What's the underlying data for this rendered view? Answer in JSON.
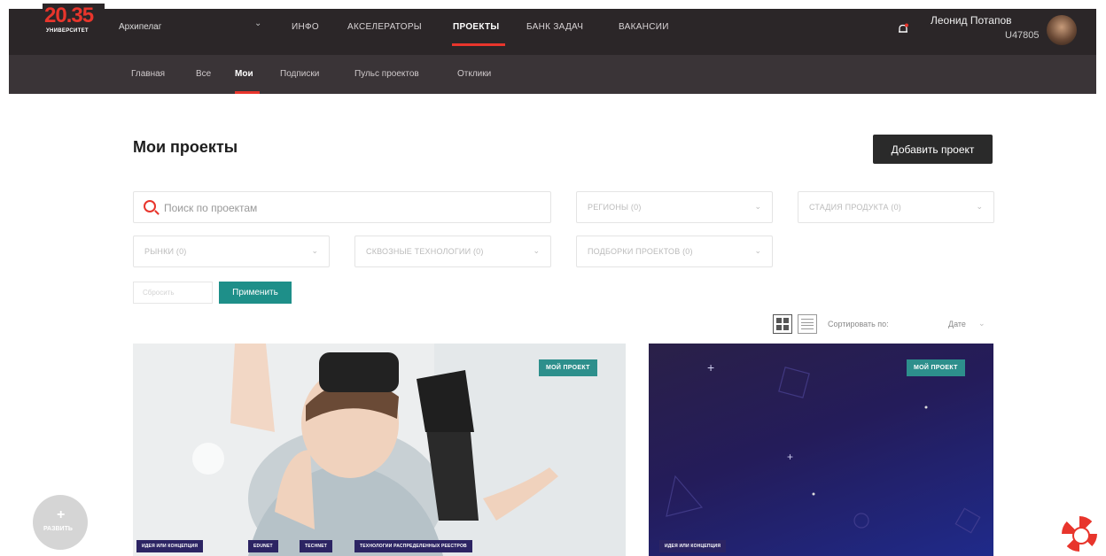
{
  "logo": {
    "number": "20.35",
    "subtitle": "УНИВЕРСИТЕТ"
  },
  "archipelago": {
    "label": "Архипелаг"
  },
  "top_nav": [
    {
      "label": "ИНФО",
      "active": false
    },
    {
      "label": "АКСЕЛЕРАТОРЫ",
      "active": false
    },
    {
      "label": "ПРОЕКТЫ",
      "active": true
    },
    {
      "label": "БАНК ЗАДАЧ",
      "active": false
    },
    {
      "label": "ВАКАНСИИ",
      "active": false
    }
  ],
  "sub_nav": [
    {
      "label": "Главная",
      "active": false
    },
    {
      "label": "Все",
      "active": false
    },
    {
      "label": "Мои",
      "active": true
    },
    {
      "label": "Подписки",
      "active": false
    },
    {
      "label": "Пульс проектов",
      "active": false
    },
    {
      "label": "Отклики",
      "active": false
    }
  ],
  "user": {
    "name": "Леонид Потапов",
    "id": "U47805"
  },
  "page": {
    "title": "Мои проекты",
    "add_button": "Добавить проект"
  },
  "filters": {
    "search_placeholder": "Поиск по проектам",
    "regions": "РЕГИОНЫ (0)",
    "product_stage": "СТАДИЯ ПРОДУКТА (0)",
    "markets": "РЫНКИ (0)",
    "cross_tech": "СКВОЗНЫЕ ТЕХНОЛОГИИ (0)",
    "selections": "ПОДБОРКИ ПРОЕКТОВ (0)",
    "reset": "Сбросить",
    "apply": "Применить"
  },
  "sort": {
    "label": "Сортировать по:",
    "value": "Дате"
  },
  "cards": [
    {
      "badge": "МОЙ ПРОЕКТ",
      "tags": [
        "ИДЕЯ ИЛИ КОНЦЕПЦИЯ",
        "EDUNET",
        "TECHNET",
        "ТЕХНОЛОГИИ РАСПРЕДЕЛЕННЫХ РЕЕСТРОВ"
      ]
    },
    {
      "badge": "МОЙ ПРОЕКТ",
      "tags": [
        "ИДЕЯ ИЛИ КОНЦЕПЦИЯ"
      ]
    }
  ],
  "help": {
    "label": "РАЗВИТЬ"
  },
  "colors": {
    "accent_red": "#e8352c",
    "teal": "#1e8f89",
    "header_dark": "#2b2628"
  }
}
